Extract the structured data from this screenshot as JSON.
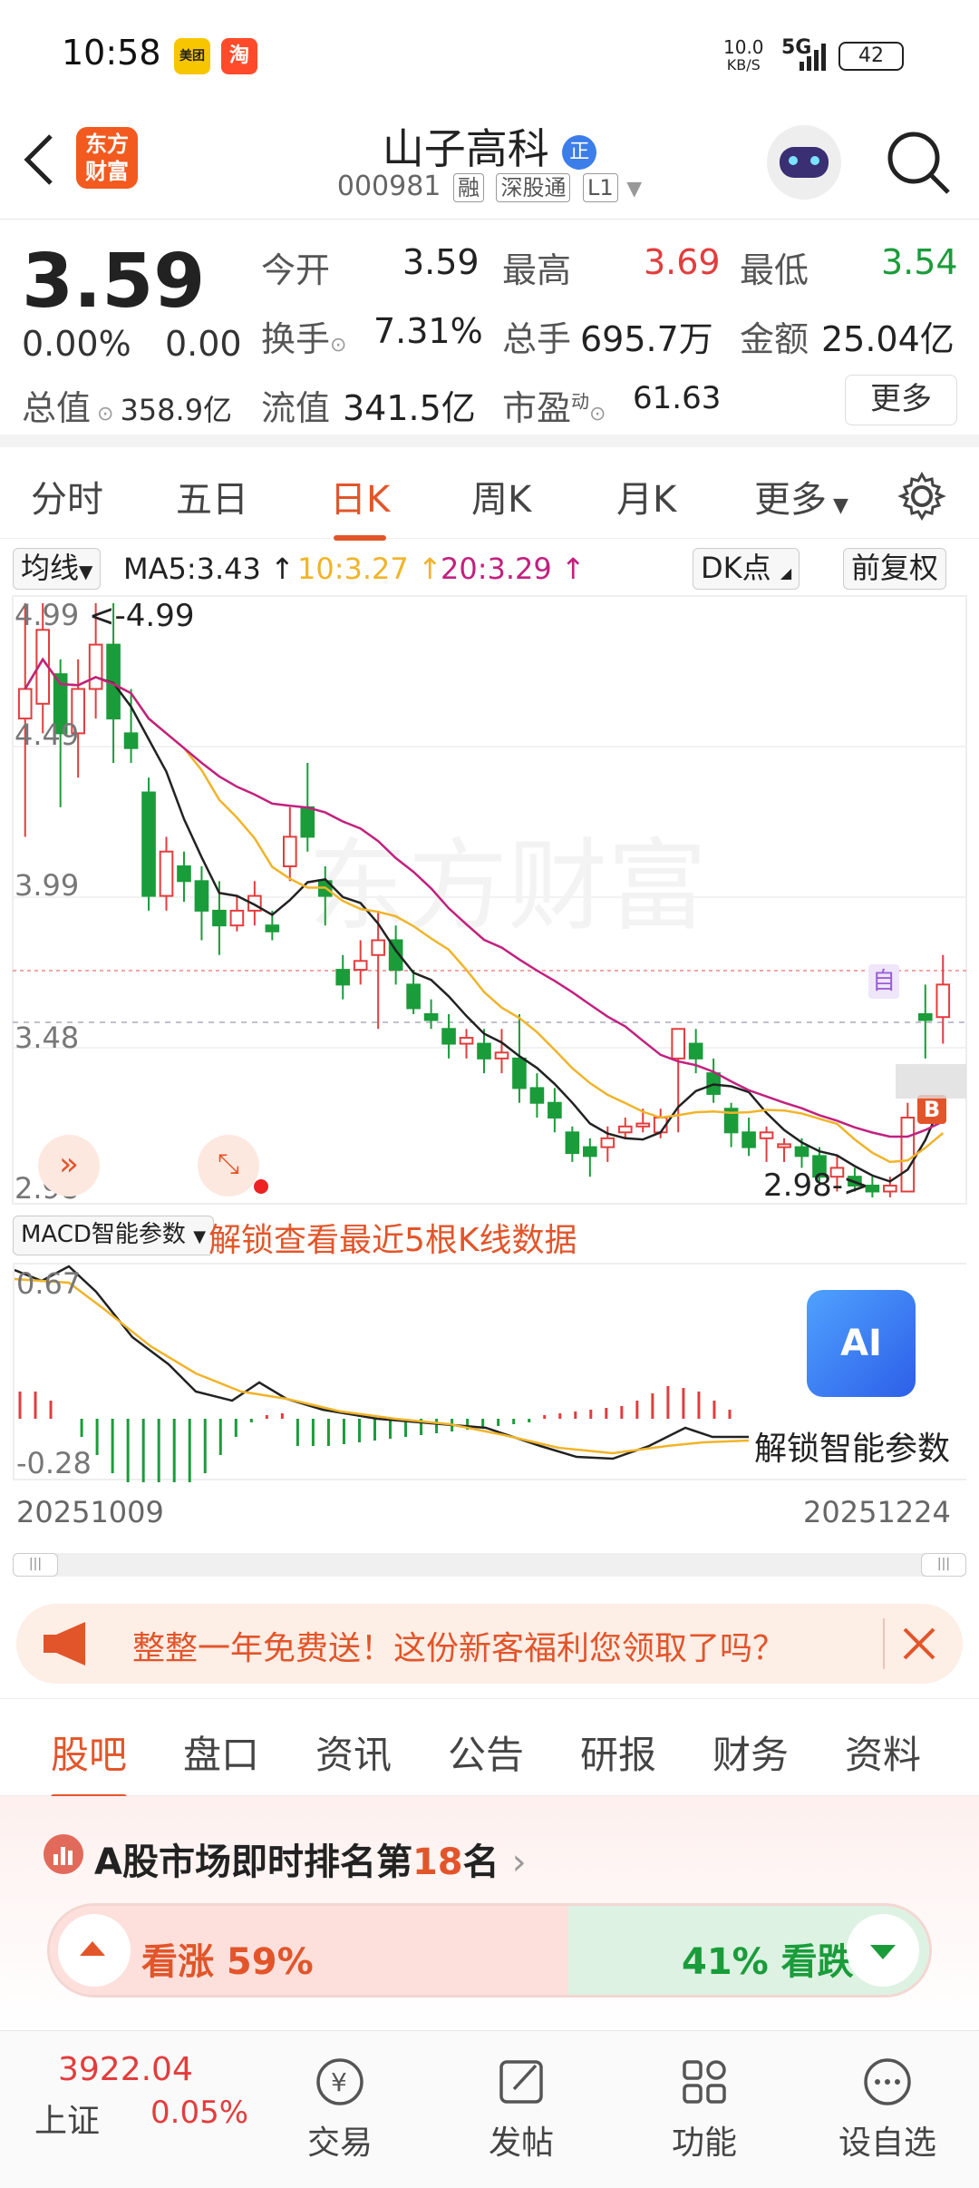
{
  "status_bar": {
    "time": "10:58",
    "net_speed": "10.0",
    "net_unit": "KB/S",
    "signal": "5G",
    "battery": "42",
    "app_badge_1": "美团",
    "app_badge_2": "淘"
  },
  "header": {
    "logo_line1": "东方",
    "logo_line2": "财富",
    "stock_name": "山子高科",
    "badge": "正",
    "stock_code": "000981",
    "tags": [
      "融",
      "深股通",
      "L1"
    ]
  },
  "quote": {
    "price": "3.59",
    "change_pct": "0.00%",
    "change": "0.00",
    "open_label": "今开",
    "open": "3.59",
    "high_label": "最高",
    "high": "3.69",
    "low_label": "最低",
    "low": "3.54",
    "turnover_label": "换手",
    "turnover": "7.31%",
    "volume_label": "总手",
    "volume": "695.7万",
    "amount_label": "金额",
    "amount": "25.04亿",
    "mcap_label": "总值",
    "mcap": "358.9亿",
    "float_label": "流值",
    "float_cap": "341.5亿",
    "pe_label": "市盈",
    "pe_sup": "动",
    "pe": "61.63",
    "more": "更多"
  },
  "kline_tabs": [
    "分时",
    "五日",
    "日K",
    "周K",
    "月K",
    "更多"
  ],
  "kline_active": 2,
  "ma": {
    "selector": "均线",
    "ma5": "MA5:3.43",
    "ma10": "10:3.27",
    "ma20": "20:3.29",
    "dk": "DK点",
    "adjust": "前复权",
    "colors": {
      "ma5": "#222222",
      "ma10": "#f0b429",
      "ma20": "#c2217f"
    }
  },
  "chart_labels": {
    "y_ticks": [
      "4.99",
      "4.49",
      "3.99",
      "3.48",
      "2.98"
    ],
    "max_annot": "<-4.99",
    "min_annot": "2.98->",
    "marker_self": "自",
    "marker_b": "B",
    "macd_selector": "MACD智能参数",
    "unlock_kline": "解锁查看最近5根K线数据",
    "macd_ticks": [
      "0.67",
      "-0.28"
    ],
    "unlock_ai": "解锁智能参数",
    "ai_label": "AI",
    "date_start": "20251009",
    "date_end": "20251224"
  },
  "chart_data": {
    "type": "candlestick",
    "ylim": [
      2.98,
      4.99
    ],
    "candles": [
      [
        4.6,
        4.7,
        4.99,
        4.2
      ],
      [
        4.65,
        4.9,
        4.99,
        4.55
      ],
      [
        4.75,
        4.55,
        4.8,
        4.3
      ],
      [
        4.55,
        4.7,
        4.8,
        4.4
      ],
      [
        4.7,
        4.85,
        4.99,
        4.6
      ],
      [
        4.85,
        4.6,
        4.99,
        4.45
      ],
      [
        4.55,
        4.5,
        4.7,
        4.45
      ],
      [
        4.35,
        4.0,
        4.4,
        3.95
      ],
      [
        4.0,
        4.15,
        4.2,
        3.95
      ],
      [
        4.1,
        4.05,
        4.15,
        3.98
      ],
      [
        4.05,
        3.95,
        4.1,
        3.85
      ],
      [
        3.95,
        3.9,
        4.05,
        3.8
      ],
      [
        3.9,
        3.95,
        4.0,
        3.88
      ],
      [
        3.95,
        4.0,
        4.05,
        3.9
      ],
      [
        3.9,
        3.88,
        3.95,
        3.85
      ],
      [
        4.1,
        4.2,
        4.3,
        4.05
      ],
      [
        4.3,
        4.2,
        4.45,
        4.15
      ],
      [
        4.05,
        4.0,
        4.1,
        3.9
      ],
      [
        3.75,
        3.7,
        3.8,
        3.65
      ],
      [
        3.75,
        3.78,
        3.85,
        3.7
      ],
      [
        3.8,
        3.85,
        3.95,
        3.55
      ],
      [
        3.85,
        3.75,
        3.9,
        3.7
      ],
      [
        3.7,
        3.62,
        3.75,
        3.6
      ],
      [
        3.6,
        3.58,
        3.65,
        3.55
      ],
      [
        3.55,
        3.5,
        3.6,
        3.45
      ],
      [
        3.5,
        3.52,
        3.55,
        3.45
      ],
      [
        3.5,
        3.45,
        3.55,
        3.4
      ],
      [
        3.45,
        3.47,
        3.55,
        3.4
      ],
      [
        3.45,
        3.35,
        3.6,
        3.3
      ],
      [
        3.35,
        3.3,
        3.4,
        3.25
      ],
      [
        3.3,
        3.25,
        3.35,
        3.2
      ],
      [
        3.2,
        3.13,
        3.22,
        3.1
      ],
      [
        3.15,
        3.12,
        3.18,
        3.05
      ],
      [
        3.15,
        3.18,
        3.22,
        3.1
      ],
      [
        3.2,
        3.22,
        3.25,
        3.18
      ],
      [
        3.22,
        3.23,
        3.28,
        3.2
      ],
      [
        3.2,
        3.25,
        3.28,
        3.18
      ],
      [
        3.45,
        3.55,
        3.55,
        3.2
      ],
      [
        3.5,
        3.45,
        3.55,
        3.4
      ],
      [
        3.4,
        3.33,
        3.45,
        3.3
      ],
      [
        3.28,
        3.2,
        3.3,
        3.15
      ],
      [
        3.2,
        3.15,
        3.25,
        3.12
      ],
      [
        3.18,
        3.2,
        3.22,
        3.1
      ],
      [
        3.15,
        3.16,
        3.18,
        3.1
      ],
      [
        3.15,
        3.12,
        3.18,
        3.08
      ],
      [
        3.12,
        3.05,
        3.15,
        3.02
      ],
      [
        3.05,
        3.08,
        3.12,
        3.0
      ],
      [
        3.05,
        3.02,
        3.08,
        3.0
      ],
      [
        3.02,
        3.0,
        3.05,
        2.98
      ],
      [
        3.0,
        3.02,
        3.05,
        2.98
      ],
      [
        3.0,
        3.25,
        3.3,
        3.0
      ],
      [
        3.6,
        3.58,
        3.7,
        3.45
      ],
      [
        3.59,
        3.7,
        3.8,
        3.5
      ]
    ],
    "macd_ylim": [
      -0.28,
      0.67
    ]
  },
  "promo": {
    "text": "整整一年免费送！这份新客福利您领取了吗？"
  },
  "sub_tabs": [
    "股吧",
    "盘口",
    "资讯",
    "公告",
    "研报",
    "财务",
    "资料"
  ],
  "sub_tab_active": 0,
  "rank": {
    "prefix": "A股市场即时排名第",
    "number": "18",
    "suffix": "名",
    "up_label": "看涨 59%",
    "down_label": "41% 看跌",
    "up_color": "#e23d3d",
    "down_color": "#1a9c3a"
  },
  "bottom_nav": {
    "index_value": "3922.04",
    "index_name": "上证",
    "index_change": "0.05%",
    "items": [
      "交易",
      "发帖",
      "功能",
      "设自选"
    ]
  }
}
